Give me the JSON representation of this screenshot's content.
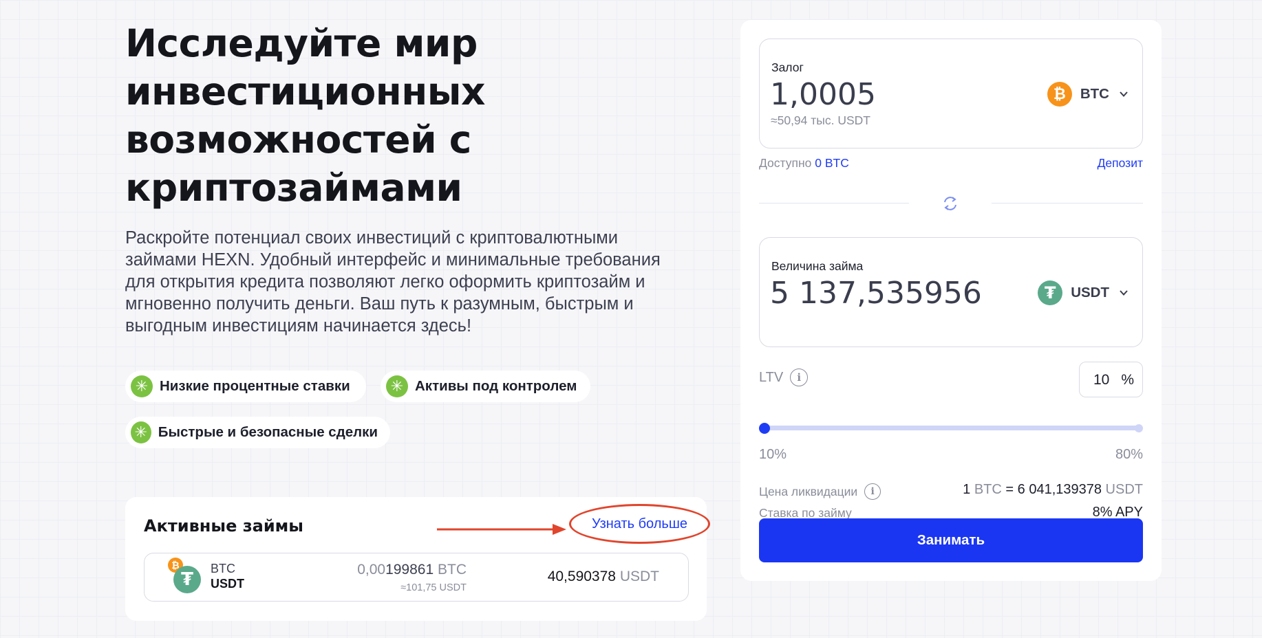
{
  "hero": {
    "title_lines": [
      "Исследуйте мир",
      "инвестиционных",
      "возможностей с",
      "криптозаймами"
    ],
    "description_lines": [
      "Раскройте потенциал своих инвестиций с криптовалютными",
      "займами HEXN. Удобный интерфейс и минимальные требования",
      "для открытия кредита позволяют легко оформить криптозайм и",
      "мгновенно получить деньги. Ваш путь к разумным, быстрым и",
      "выгодным инвестициям начинается здесь!"
    ]
  },
  "features": [
    {
      "label": "Низкие процентные ставки",
      "icon": "check-icon"
    },
    {
      "label": "Активы под контролем",
      "icon": "check-icon"
    },
    {
      "label": "Быстрые и безопасные сделки",
      "icon": "check-icon"
    }
  ],
  "active_loans": {
    "title": "Активные займы",
    "learn_more": "Узнать больше",
    "rows": [
      {
        "collateral_symbol": "BTC",
        "loan_symbol": "USDT",
        "collateral_amount_prefix": "0,00",
        "collateral_amount_main": "199861",
        "collateral_unit": "BTC",
        "collateral_approx": "≈101,75 USDT",
        "loan_amount": "40,590378",
        "loan_unit": "USDT"
      }
    ]
  },
  "calculator": {
    "collateral": {
      "label": "Залог",
      "value": "1,0005",
      "approx": "≈50,94 тыс. USDT",
      "currency": "BTC",
      "currency_icon": "bitcoin-icon"
    },
    "available_label": "Доступно",
    "available_value": "0 BTC",
    "deposit_link": "Депозит",
    "loan": {
      "label": "Величина займа",
      "value": "5 137,535956",
      "currency": "USDT",
      "currency_icon": "tether-icon"
    },
    "ltv": {
      "label": "LTV",
      "value": "10",
      "unit": "%",
      "min_label": "10%",
      "max_label": "80%",
      "slider_fraction": 0
    },
    "liquidation": {
      "label": "Цена ликвидации",
      "left_amount": "1",
      "left_unit": "BTC",
      "equals": "=",
      "right_amount": "6 041,139378",
      "right_unit": "USDT"
    },
    "rate": {
      "label": "Ставка по займу",
      "value": "8% APY"
    },
    "submit_label": "Занимать"
  },
  "colors": {
    "accent": "#1a36f2",
    "link": "#1f3cf5",
    "check": "#7cc242",
    "btc": "#f7931a",
    "usdt": "#5aa98b",
    "annotation": "#e0452d"
  }
}
